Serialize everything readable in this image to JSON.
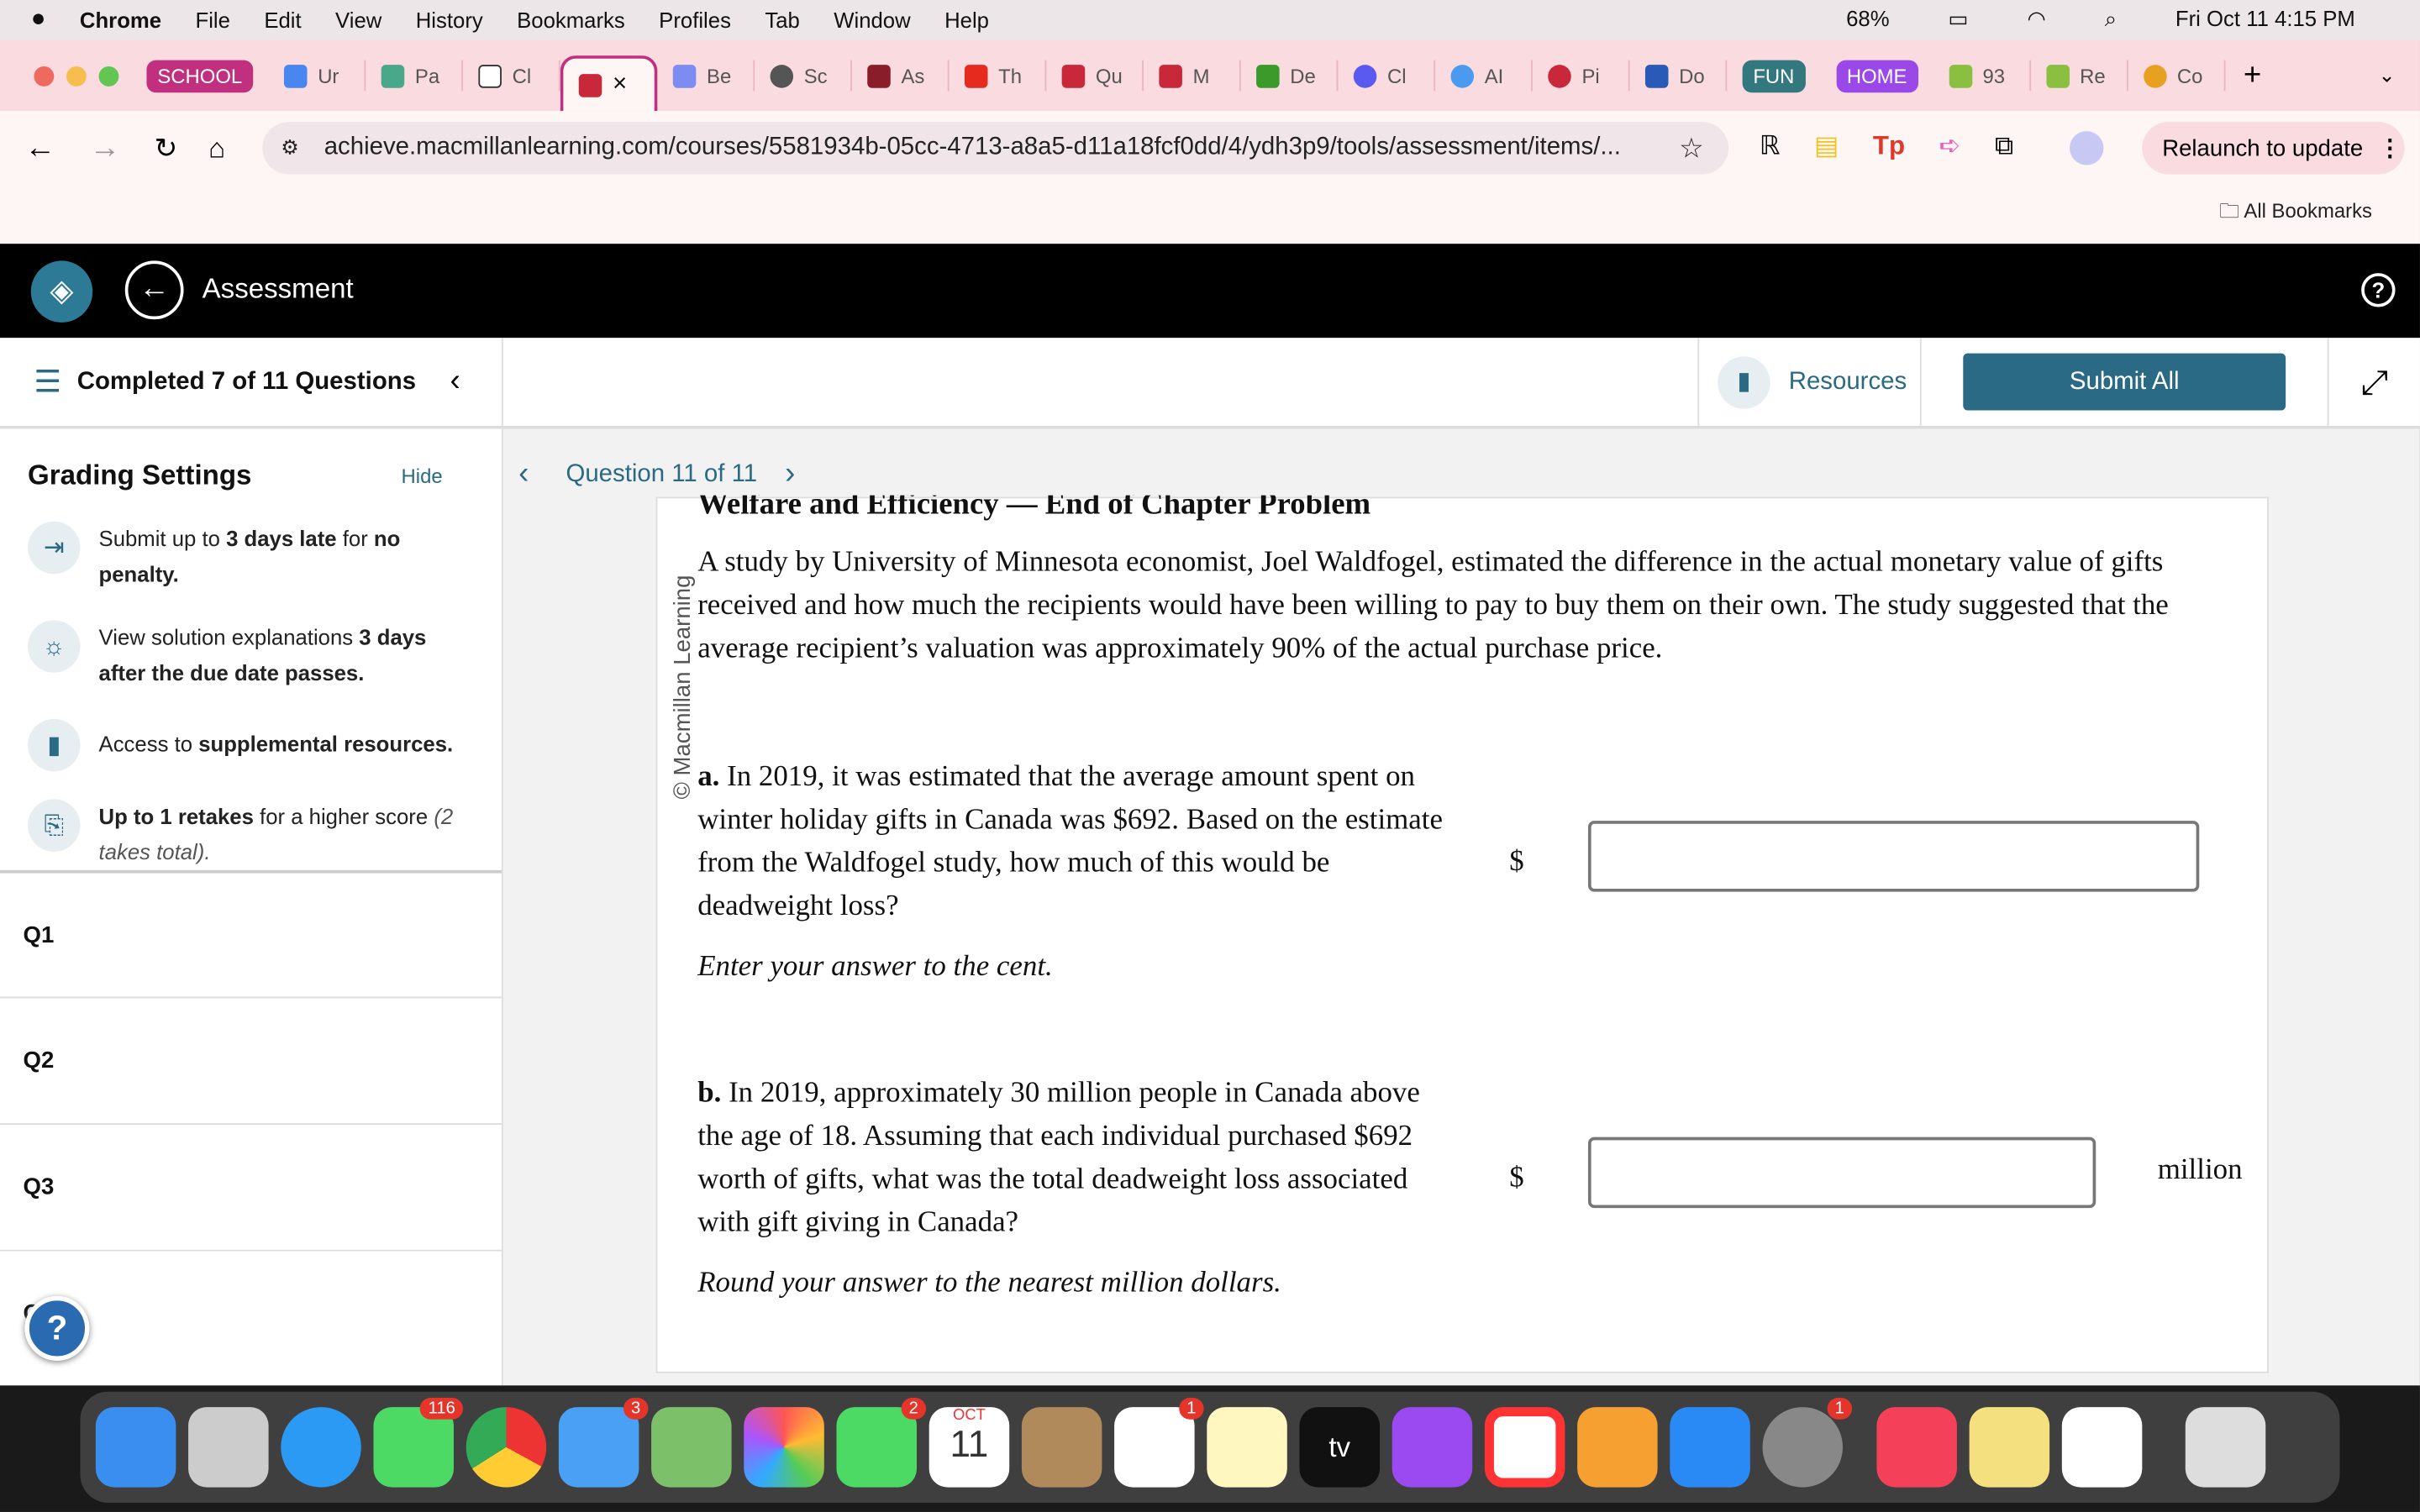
{
  "menubar": {
    "app": "Chrome",
    "items": [
      "File",
      "Edit",
      "View",
      "History",
      "Bookmarks",
      "Profiles",
      "Tab",
      "Window",
      "Help"
    ],
    "battery": "68%",
    "datetime": "Fri Oct 11  4:15 PM"
  },
  "tabs": {
    "groups": {
      "school": "SCHOOL",
      "fun": "FUN",
      "home": "HOME"
    },
    "school_tabs": [
      "Ur",
      "Pa",
      "Cl",
      "",
      "Be",
      "Sc",
      "As",
      "Th",
      "Qu",
      "M"
    ],
    "other_tabs": [
      "De",
      "Cl",
      "AI",
      "Pi",
      "Do"
    ],
    "home_tabs": [
      "93",
      "Re",
      "Co"
    ],
    "active_close": "×",
    "new_tab": "+"
  },
  "toolbar": {
    "url": "achieve.macmillanlearning.com/courses/5581934b-05cc-4713-a8a5-d11a18fcf0dd/4/ydh3p9/tools/assessment/items/...",
    "relaunch": "Relaunch to update",
    "all_bookmarks": "All Bookmarks"
  },
  "appbar": {
    "title": "Assessment",
    "help": "?"
  },
  "subheader": {
    "progress": "Completed 7 of 11 Questions",
    "resources": "Resources",
    "submit": "Submit All"
  },
  "grading": {
    "title": "Grading Settings",
    "hide": "Hide",
    "items": [
      {
        "pre": "Submit up to ",
        "b1": "3 days late",
        "mid": " for ",
        "b2": "no penalty."
      },
      {
        "pre": "View solution explanations ",
        "b1": "3 days after the due date passes.",
        "mid": "",
        "b2": ""
      },
      {
        "pre": "Access to ",
        "b1": "supplemental resources.",
        "mid": "",
        "b2": ""
      },
      {
        "pre": "",
        "b1": "Up to 1 retakes",
        "mid": " for a higher score ",
        "b2": "(2 takes total)."
      }
    ]
  },
  "questions": [
    "Q1",
    "Q2",
    "Q3",
    "Q"
  ],
  "nav": {
    "label": "Question 11 of 11"
  },
  "card": {
    "title": "Welfare and Efficiency — End of Chapter Problem",
    "watermark": "© Macmillan Learning",
    "intro": "A study by University of Minnesota economist, Joel Waldfogel, estimated the difference in the actual monetary value of gifts received and how much the recipients would have been willing to pay to buy them on their own. The study suggested that the average recipient’s valuation was approximately 90% of the actual purchase price.",
    "a": {
      "label": "a.",
      "text": " In 2019, it was estimated that the average amount spent on winter holiday gifts in Canada was $692. Based on the estimate from the Waldfogel study, how much of this would be deadweight loss?",
      "hint": "Enter your answer to the cent.",
      "currency": "$",
      "value": ""
    },
    "b": {
      "label": "b.",
      "text": " In 2019, approximately 30 million people in Canada above the age of 18. Assuming that each individual purchased $692 worth of gifts, what was the total deadweight loss associated with gift giving in Canada?",
      "hint": "Round your answer to the nearest million dollars.",
      "currency": "$",
      "unit": "million",
      "value": ""
    }
  },
  "dock": {
    "badges": {
      "messages": "116",
      "mail": "3",
      "facetime": "2",
      "reminders": "1",
      "settings": "1"
    },
    "calendar": {
      "month": "OCT",
      "day": "11"
    },
    "tv": "tv"
  }
}
